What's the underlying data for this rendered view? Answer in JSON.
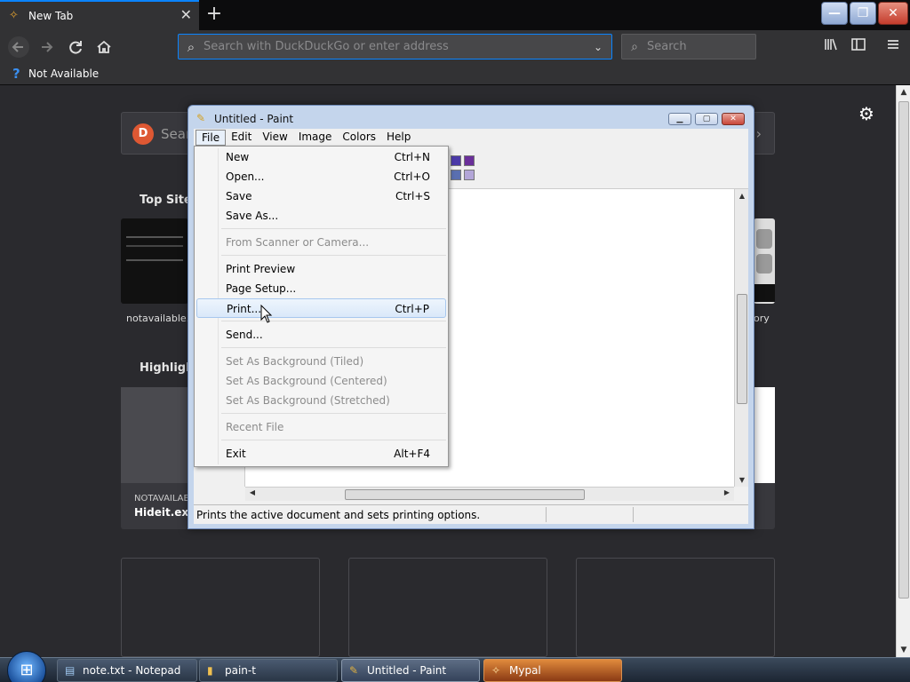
{
  "browser": {
    "tab_title": "New Tab",
    "tab_close": "✕",
    "new_tab_glyph": "+",
    "url_placeholder": "Search with DuckDuckGo or enter address",
    "search_placeholder": "Search",
    "bookmark_label": "Not Available",
    "window_controls": {
      "minimize": "—",
      "maximize": "❐",
      "close": "✕"
    }
  },
  "newtab": {
    "search_label": "Sear",
    "top_sites_title": "Top Sites",
    "highlights_title": "Highligh",
    "tile_label_left": "notavailable.",
    "tile_label_right": "ory",
    "highlight_source": "NOTAVAILAB",
    "highlight_title": "Hideit.exe"
  },
  "paint": {
    "title": "Untitled - Paint",
    "menus": [
      "File",
      "Edit",
      "View",
      "Image",
      "Colors",
      "Help"
    ],
    "status_text": "Prints the active document and sets printing options.",
    "palette_colors": [
      "#4b3aa8",
      "#6a2f9a",
      "#5a6fb0",
      "#b3a6d8"
    ]
  },
  "file_menu": {
    "items": [
      {
        "label": "New",
        "shortcut": "Ctrl+N",
        "disabled": false
      },
      {
        "label": "Open...",
        "shortcut": "Ctrl+O",
        "disabled": false
      },
      {
        "label": "Save",
        "shortcut": "Ctrl+S",
        "disabled": false
      },
      {
        "label": "Save As...",
        "shortcut": "",
        "disabled": false
      },
      {
        "label": "From Scanner or Camera...",
        "shortcut": "",
        "disabled": true
      },
      {
        "label": "Print Preview",
        "shortcut": "",
        "disabled": false
      },
      {
        "label": "Page Setup...",
        "shortcut": "",
        "disabled": false
      },
      {
        "label": "Print...",
        "shortcut": "Ctrl+P",
        "disabled": false,
        "highlighted": true
      },
      {
        "label": "Send...",
        "shortcut": "",
        "disabled": false
      },
      {
        "label": "Set As Background (Tiled)",
        "shortcut": "",
        "disabled": true
      },
      {
        "label": "Set As Background (Centered)",
        "shortcut": "",
        "disabled": true
      },
      {
        "label": "Set As Background (Stretched)",
        "shortcut": "",
        "disabled": true
      },
      {
        "label": "Recent File",
        "shortcut": "",
        "disabled": true
      },
      {
        "label": "Exit",
        "shortcut": "Alt+F4",
        "disabled": false
      }
    ]
  },
  "taskbar": {
    "items": [
      {
        "label": "note.txt - Notepad",
        "icon": "notepad-icon"
      },
      {
        "label": "pain-t",
        "icon": "folder-icon"
      },
      {
        "label": "Untitled - Paint",
        "icon": "paint-icon"
      },
      {
        "label": "Mypal",
        "icon": "mypal-icon"
      }
    ]
  }
}
